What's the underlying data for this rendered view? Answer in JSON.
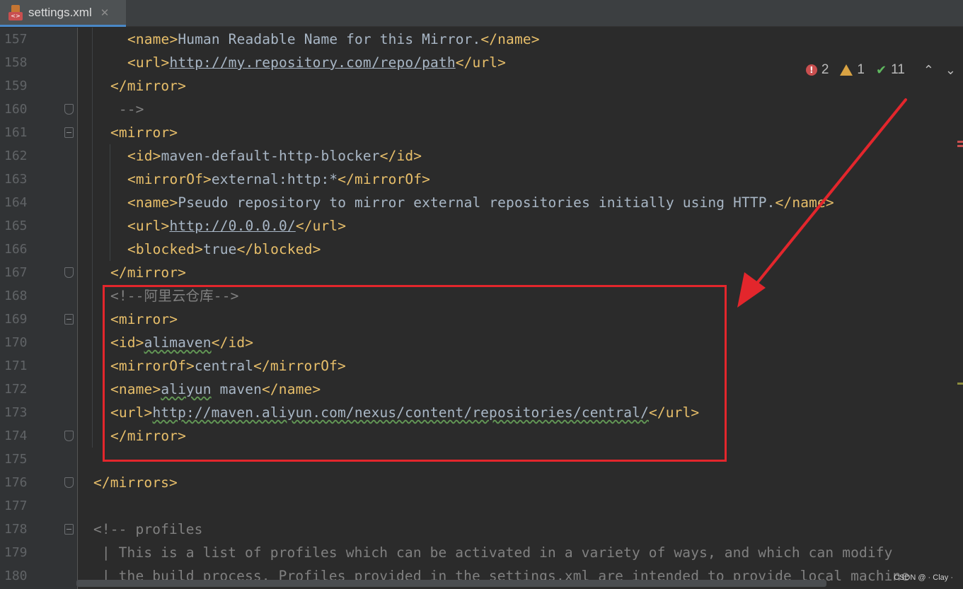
{
  "tab": {
    "label": "settings.xml",
    "icon": "xml-file-icon",
    "close": "✕",
    "icon_text": "<>"
  },
  "inspections": {
    "errors": "2",
    "warnings": "1",
    "ok": "11",
    "up": "⌃",
    "down": "⌄"
  },
  "lines": [
    {
      "n": "157",
      "indent": 180,
      "fold": "",
      "parts": [
        {
          "c": "tag",
          "t": "<name>"
        },
        {
          "c": "tx",
          "t": "Human Readable Name for this Mirror."
        },
        {
          "c": "tag",
          "t": "</name>"
        }
      ]
    },
    {
      "n": "158",
      "indent": 180,
      "fold": "",
      "parts": [
        {
          "c": "tag",
          "t": "<url>"
        },
        {
          "c": "tx ul",
          "t": "http://my.repository.com/repo/path"
        },
        {
          "c": "tag",
          "t": "</url>"
        }
      ]
    },
    {
      "n": "159",
      "indent": 156,
      "fold": "",
      "parts": [
        {
          "c": "tag",
          "t": "</mirror>"
        }
      ]
    },
    {
      "n": "160",
      "indent": 156,
      "fold": "end",
      "parts": [
        {
          "c": "cm",
          "t": " -->"
        }
      ]
    },
    {
      "n": "161",
      "indent": 156,
      "fold": "open",
      "parts": [
        {
          "c": "tag",
          "t": "<mirror>"
        }
      ]
    },
    {
      "n": "162",
      "indent": 180,
      "fold": "",
      "parts": [
        {
          "c": "tag",
          "t": "<id>"
        },
        {
          "c": "tx",
          "t": "maven-default-http-blocker"
        },
        {
          "c": "tag",
          "t": "</id>"
        }
      ]
    },
    {
      "n": "163",
      "indent": 180,
      "fold": "",
      "parts": [
        {
          "c": "tag",
          "t": "<mirrorOf>"
        },
        {
          "c": "tx",
          "t": "external:http:*"
        },
        {
          "c": "tag",
          "t": "</mirrorOf>"
        }
      ]
    },
    {
      "n": "164",
      "indent": 180,
      "fold": "",
      "parts": [
        {
          "c": "tag",
          "t": "<name>"
        },
        {
          "c": "tx",
          "t": "Pseudo repository to mirror external repositories initially using HTTP."
        },
        {
          "c": "tag",
          "t": "</name>"
        }
      ]
    },
    {
      "n": "165",
      "indent": 180,
      "fold": "",
      "parts": [
        {
          "c": "tag",
          "t": "<url>"
        },
        {
          "c": "tx ul",
          "t": "http://0.0.0.0/"
        },
        {
          "c": "tag",
          "t": "</url>"
        }
      ]
    },
    {
      "n": "166",
      "indent": 180,
      "fold": "",
      "parts": [
        {
          "c": "tag",
          "t": "<blocked>"
        },
        {
          "c": "tx",
          "t": "true"
        },
        {
          "c": "tag",
          "t": "</blocked>"
        }
      ]
    },
    {
      "n": "167",
      "indent": 156,
      "fold": "end",
      "parts": [
        {
          "c": "tag",
          "t": "</mirror>"
        }
      ]
    },
    {
      "n": "168",
      "indent": 156,
      "fold": "",
      "parts": [
        {
          "c": "cm",
          "t": "<!--阿里云仓库-->"
        }
      ]
    },
    {
      "n": "169",
      "indent": 156,
      "fold": "open",
      "parts": [
        {
          "c": "tag",
          "t": "<mirror>"
        }
      ]
    },
    {
      "n": "170",
      "indent": 156,
      "fold": "",
      "parts": [
        {
          "c": "tag",
          "t": "<id>"
        },
        {
          "c": "tx sq",
          "t": "alimaven"
        },
        {
          "c": "tag",
          "t": "</id>"
        }
      ]
    },
    {
      "n": "171",
      "indent": 156,
      "fold": "",
      "parts": [
        {
          "c": "tag",
          "t": "<mirrorOf>"
        },
        {
          "c": "tx",
          "t": "central"
        },
        {
          "c": "tag",
          "t": "</mirrorOf>"
        }
      ]
    },
    {
      "n": "172",
      "indent": 156,
      "fold": "",
      "parts": [
        {
          "c": "tag",
          "t": "<name>"
        },
        {
          "c": "tx sq",
          "t": "aliyun"
        },
        {
          "c": "tx",
          "t": " maven"
        },
        {
          "c": "tag",
          "t": "</name>"
        }
      ]
    },
    {
      "n": "173",
      "indent": 156,
      "fold": "",
      "parts": [
        {
          "c": "tag",
          "t": "<url>"
        },
        {
          "c": "tx ul sq",
          "t": "http://maven.aliyun.com/nexus/content/repositories/central/"
        },
        {
          "c": "tag",
          "t": "</url>"
        }
      ]
    },
    {
      "n": "174",
      "indent": 156,
      "fold": "end",
      "parts": [
        {
          "c": "tag",
          "t": "</mirror>"
        }
      ]
    },
    {
      "n": "175",
      "indent": 156,
      "fold": "",
      "parts": []
    },
    {
      "n": "176",
      "indent": 132,
      "fold": "end",
      "parts": [
        {
          "c": "tag",
          "t": "</mirrors>"
        }
      ]
    },
    {
      "n": "177",
      "indent": 132,
      "fold": "",
      "parts": []
    },
    {
      "n": "178",
      "indent": 132,
      "fold": "open",
      "parts": [
        {
          "c": "cm",
          "t": "<!-- profiles"
        }
      ]
    },
    {
      "n": "179",
      "indent": 132,
      "fold": "",
      "parts": [
        {
          "c": "cm",
          "t": " | This is a list of profiles which can be activated in a variety of ways, and which can modify"
        }
      ]
    },
    {
      "n": "180",
      "indent": 132,
      "fold": "",
      "parts": [
        {
          "c": "cm",
          "t": " | the build process. Profiles provided in the settings.xml are intended to provide local machine"
        }
      ]
    }
  ],
  "watermark": "CSDN @ · Clay ·",
  "colors": {
    "tag": "#e8bf6a",
    "text": "#a9b7c6",
    "comment": "#808080",
    "annotation": "#e3262c"
  }
}
